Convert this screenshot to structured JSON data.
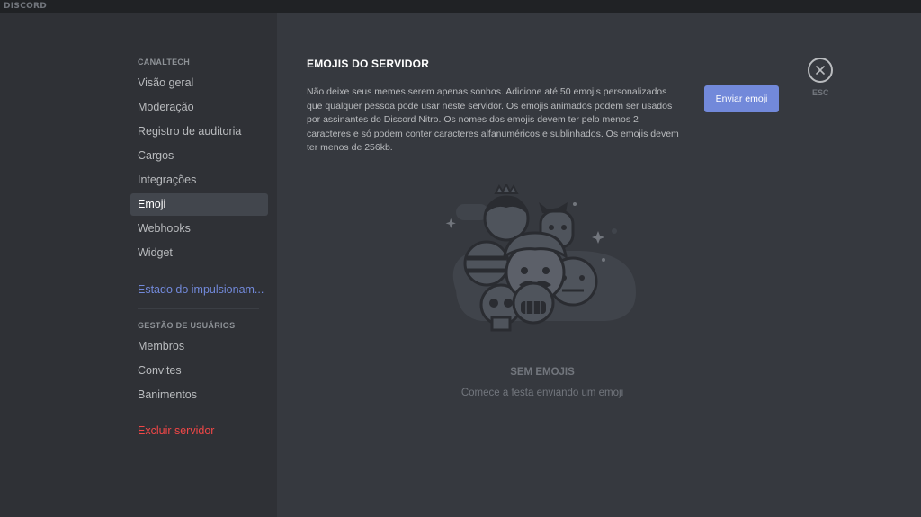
{
  "app": {
    "brand": "DISCORD"
  },
  "sidebar": {
    "server_header": "CANALTECH",
    "items": [
      {
        "label": "Visão geral"
      },
      {
        "label": "Moderação"
      },
      {
        "label": "Registro de auditoria"
      },
      {
        "label": "Cargos"
      },
      {
        "label": "Integrações"
      },
      {
        "label": "Emoji"
      },
      {
        "label": "Webhooks"
      },
      {
        "label": "Widget"
      }
    ],
    "boost_item": "Estado do impulsionam...",
    "user_management_header": "GESTÃO DE USUÁRIOS",
    "user_items": [
      {
        "label": "Membros"
      },
      {
        "label": "Convites"
      },
      {
        "label": "Banimentos"
      }
    ],
    "delete_server": "Excluir servidor"
  },
  "main": {
    "title": "EMOJIS DO SERVIDOR",
    "description": "Não deixe seus memes serem apenas sonhos. Adicione até 50 emojis personalizados que qualquer pessoa pode usar neste servidor. Os emojis animados podem ser usados por assinantes do Discord Nitro. Os nomes dos emojis devem ter pelo menos 2 caracteres e só podem conter caracteres alfanuméricos e sublinhados. Os emojis devem ter menos de 256kb.",
    "upload_button": "Enviar emoji",
    "empty_title": "SEM EMOJIS",
    "empty_subtitle": "Comece a festa enviando um emoji"
  },
  "close": {
    "label": "ESC"
  },
  "colors": {
    "accent": "#7289da",
    "danger": "#f04747",
    "sidebar_bg": "#2f3136",
    "content_bg": "#36393f"
  }
}
